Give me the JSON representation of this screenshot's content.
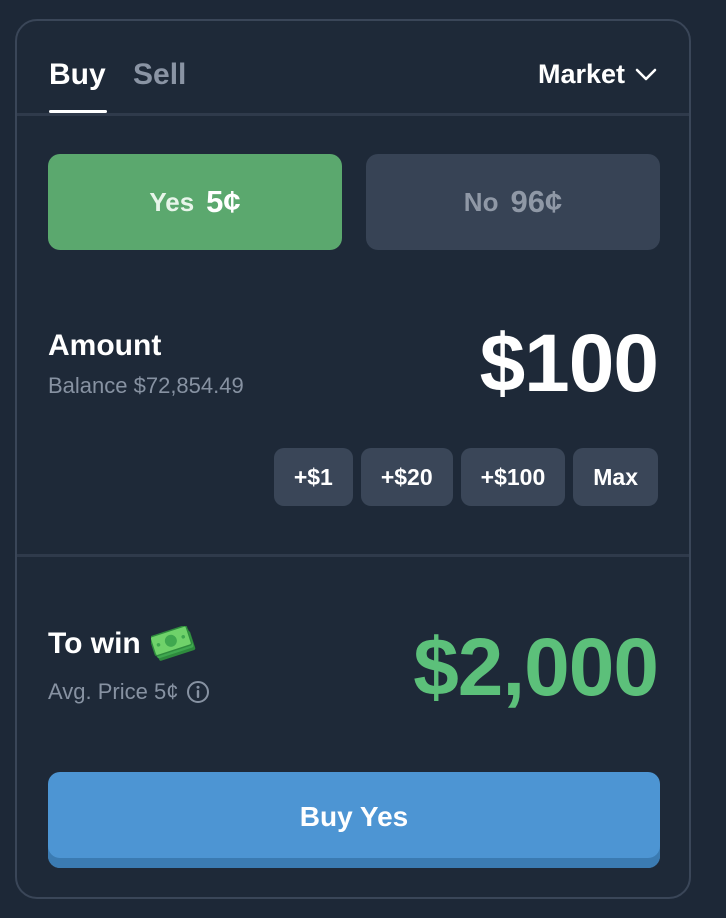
{
  "tabs": {
    "buy": "Buy",
    "sell": "Sell",
    "active": "Buy"
  },
  "order_type": {
    "label": "Market",
    "icon": "chevron-down-icon"
  },
  "outcomes": {
    "yes": {
      "label": "Yes",
      "price": "5¢",
      "selected": true,
      "color": "#5ba86e"
    },
    "no": {
      "label": "No",
      "price": "96¢",
      "selected": false,
      "color": "#374355"
    }
  },
  "amount": {
    "label": "Amount",
    "balance": "Balance $72,854.49",
    "value": "$100"
  },
  "quick_add": [
    "+$1",
    "+$20",
    "+$100",
    "Max"
  ],
  "to_win": {
    "label": "To win",
    "icon": "money-icon",
    "avg_price": "Avg. Price 5¢",
    "info_icon": "info-icon",
    "value": "$2,000",
    "color": "#5cc07a"
  },
  "submit": {
    "label": "Buy Yes",
    "color": "#4d95d3"
  }
}
